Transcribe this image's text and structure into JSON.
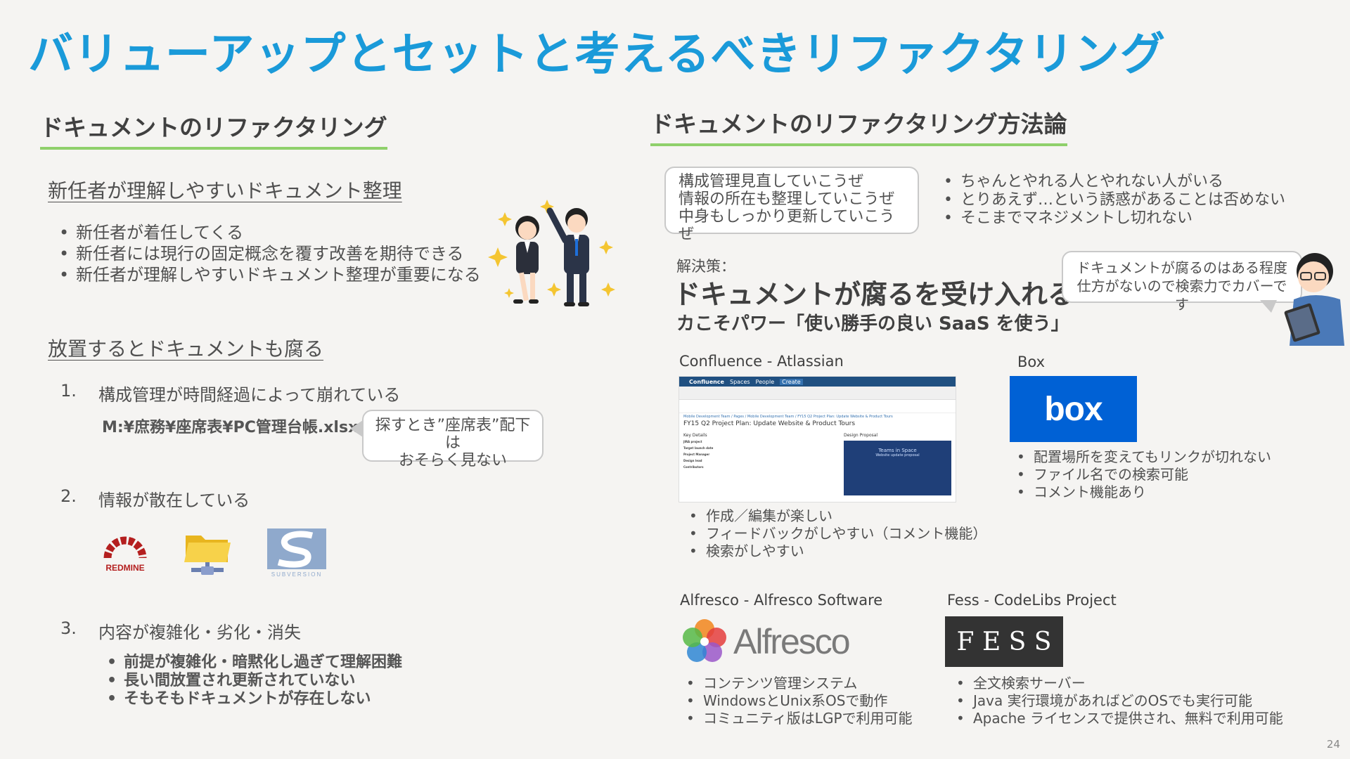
{
  "title": "バリューアップとセットと考えるべきリファクタリング",
  "left": {
    "heading": "ドキュメントのリファクタリング",
    "section1": {
      "title": "新任者が理解しやすいドキュメント整理",
      "bullets": [
        "新任者が着任してくる",
        "新任者には現行の固定概念を覆す改善を期待できる",
        "新任者が理解しやすいドキュメント整理が重要になる"
      ]
    },
    "section2": {
      "title": "放置するとドキュメントも腐る",
      "item1": {
        "num": "1.",
        "text": "構成管理が時間経過によって崩れている"
      },
      "path": "M:¥庶務¥座席表¥PC管理台帳.xlsx",
      "bubble": [
        "探すとき”座席表”配下は",
        "おそらく見ない"
      ],
      "item2": {
        "num": "2.",
        "text": "情報が散在している"
      },
      "logos": {
        "redmine": "REDMINE",
        "subversion": "SUBVERSION"
      },
      "item3": {
        "num": "3.",
        "text": "内容が複雑化・劣化・消失"
      },
      "sub_bullets": [
        "前提が複雑化・暗黙化し過ぎて理解困難",
        "長い間放置され更新されていない",
        "そもそもドキュメントが存在しない"
      ]
    }
  },
  "right": {
    "heading": "ドキュメントのリファクタリング方法論",
    "bubble": [
      "構成管理見直していこうぜ",
      "情報の所在も整理していこうぜ",
      "中身もしっかり更新していこうぜ"
    ],
    "bullets": [
      "ちゃんとやれる人とやれない人がいる",
      "とりあえず…という誘惑があることは否めない",
      "そこまでマネジメントし切れない"
    ],
    "solution_label": "解決策：",
    "solution_main": "ドキュメントが腐るを受け入れる",
    "solution_sub": "カこそパワー「使い勝手の良い SaaS を使う」",
    "speech": [
      "ドキュメントが腐るのはある程度",
      "仕方がないので検索力でカバーです"
    ],
    "confluence": {
      "label": "Confluence - Atlassian",
      "shot": {
        "brand": "Confluence",
        "nav": [
          "Spaces",
          "People",
          "Create"
        ],
        "breadcrumb": "Mobile Development Team / Pages / Mobile Development Team / FY15 Q2 Project Plan: Update Website & Product Tours",
        "page_title": "FY15 Q2 Project Plan: Update Website & Product Tours",
        "key_details": "Key Details",
        "design": "Design Proposal",
        "rows": [
          "JIRA project",
          "Target launch date",
          "Project Manager",
          "Design lead",
          "Contributors"
        ],
        "preview_title": "Teams in Space",
        "preview_sub": "Website update proposal"
      },
      "bullets": [
        "作成／編集が楽しい",
        "フィードバックがしやすい（コメント機能）",
        "検索がしやすい"
      ]
    },
    "box": {
      "label": "Box",
      "logo": "box",
      "bullets": [
        "配置場所を変えてもリンクが切れない",
        "ファイル名での検索可能",
        "コメント機能あり"
      ]
    },
    "alfresco": {
      "label": "Alfresco - Alfresco Software",
      "logo": "Alfresco",
      "bullets": [
        "コンテンツ管理システム",
        "WindowsとUnix系OSで動作",
        "コミュニティ版はLGPで利用可能"
      ]
    },
    "fess": {
      "label": "Fess - CodeLibs Project",
      "logo": "F E S S",
      "bullets": [
        "全文検索サーバー",
        "Java 実行環境があればどのOSでも実行可能",
        "Apache ライセンスで提供され、無料で利用可能"
      ]
    }
  },
  "page_number": "24",
  "colors": {
    "title": "#1a9ad9",
    "underline": "#8fd06b",
    "box": "#0061d5",
    "fess_bg": "#333333"
  }
}
